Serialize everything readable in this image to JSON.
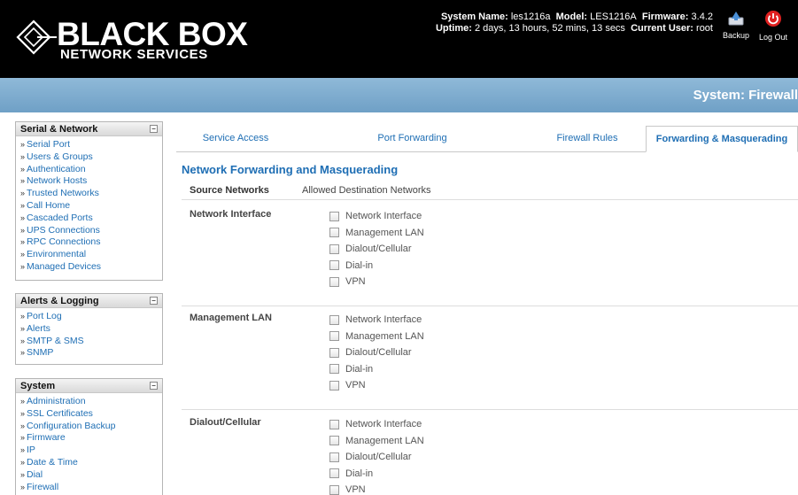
{
  "brand": {
    "name": "BLACK BOX",
    "tagline": "NETWORK SERVICES"
  },
  "sysinfo": {
    "line1": [
      {
        "label": "System Name:",
        "value": "les1216a"
      },
      {
        "label": "Model:",
        "value": "LES1216A"
      },
      {
        "label": "Firmware:",
        "value": "3.4.2"
      }
    ],
    "line2": [
      {
        "label": "Uptime:",
        "value": "2 days, 13 hours, 52 mins, 13 secs"
      },
      {
        "label": "Current User:",
        "value": "root"
      }
    ]
  },
  "header_buttons": {
    "backup": "Backup",
    "logout": "Log Out"
  },
  "page_title": "System: Firewall",
  "sidebar": [
    {
      "title": "Serial & Network",
      "items": [
        "Serial Port",
        "Users & Groups",
        "Authentication",
        "Network Hosts",
        "Trusted Networks",
        "Call Home",
        "Cascaded Ports",
        "UPS Connections",
        "RPC Connections",
        "Environmental",
        "Managed Devices"
      ]
    },
    {
      "title": "Alerts & Logging",
      "items": [
        "Port Log",
        "Alerts",
        "SMTP & SMS",
        "SNMP"
      ]
    },
    {
      "title": "System",
      "items": [
        "Administration",
        "SSL Certificates",
        "Configuration Backup",
        "Firmware",
        "IP",
        "Date & Time",
        "Dial",
        "Firewall"
      ]
    }
  ],
  "tabs": [
    "Service Access",
    "Port Forwarding",
    "Firewall Rules",
    "Forwarding & Masquerading"
  ],
  "active_tab": 3,
  "section_title": "Network Forwarding and Masquerading",
  "columns": {
    "source": "Source Networks",
    "destination": "Allowed Destination Networks"
  },
  "groups": [
    {
      "name": "Network Interface",
      "options": [
        "Network Interface",
        "Management LAN",
        "Dialout/Cellular",
        "Dial-in",
        "VPN"
      ]
    },
    {
      "name": "Management LAN",
      "options": [
        "Network Interface",
        "Management LAN",
        "Dialout/Cellular",
        "Dial-in",
        "VPN"
      ]
    },
    {
      "name": "Dialout/Cellular",
      "options": [
        "Network Interface",
        "Management LAN",
        "Dialout/Cellular",
        "Dial-in",
        "VPN"
      ]
    }
  ],
  "colors": {
    "link": "#1e6eb4",
    "header_bg": "#000000",
    "band": "#7aaad0",
    "logout_red": "#e02020"
  },
  "icons": {
    "backup": "backup-icon",
    "logout": "power-icon",
    "collapse": "collapse-icon",
    "logo": "diamond-logo-icon"
  }
}
